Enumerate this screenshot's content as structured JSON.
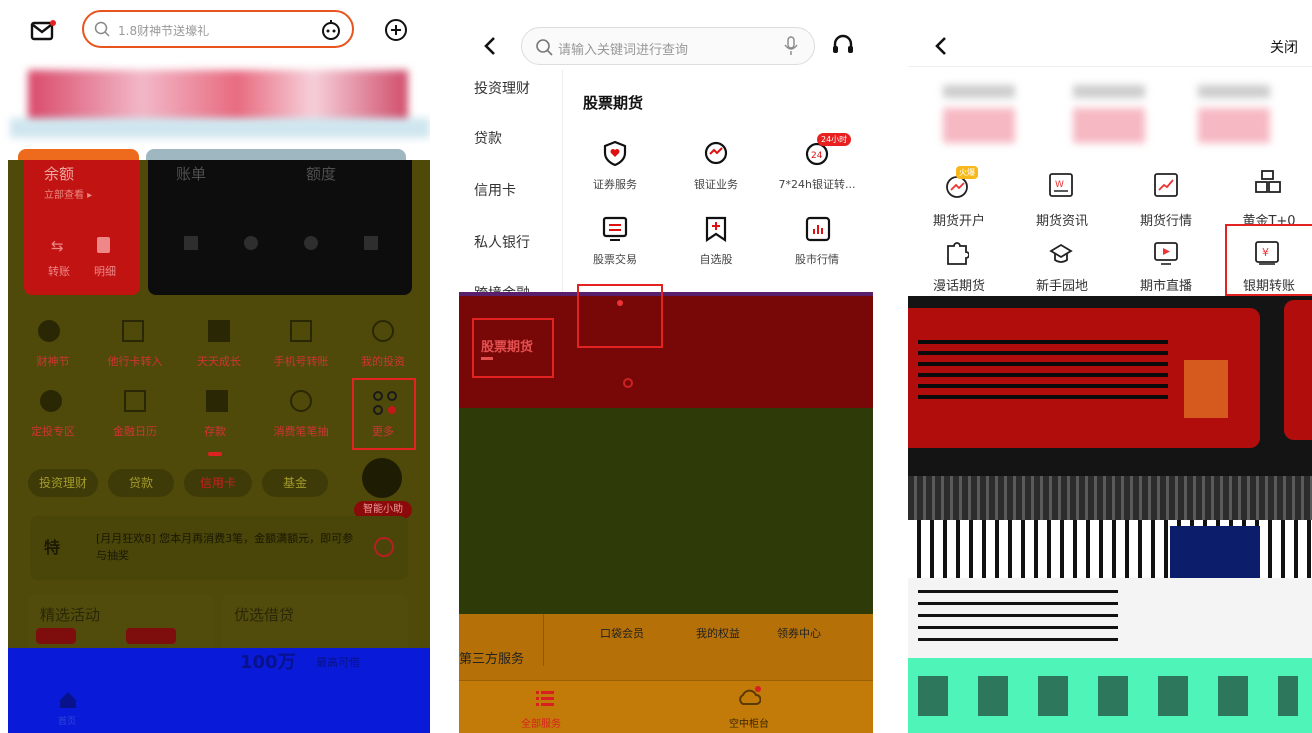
{
  "panel1": {
    "search_placeholder": "1.8财神节送壕礼",
    "tabs": [
      "余额",
      "账单",
      "额度"
    ],
    "balance_link": "立部查看 ▸",
    "quick_actions": [
      "转账",
      "明细"
    ],
    "grid_row1": [
      "财神节",
      "他行卡转入",
      "天天成长",
      "手机号转账",
      "我的投资"
    ],
    "grid_row2": [
      "定投专区",
      "金融日历",
      "存款",
      "消费笔笔抽",
      "更多"
    ],
    "categories": [
      "投资理财",
      "贷款",
      "信用卡",
      "基金"
    ],
    "notice": "[月月狂欢8] 您本月再消费3笔，金额满额元，即可参与抽奖",
    "section_left": "精选活动",
    "section_right": "优选借贷",
    "loan_amount": "100万",
    "loan_caption": "最高可借",
    "assistant_badge": "智能小助",
    "bottom_nav": "首页"
  },
  "panel2": {
    "search_placeholder": "请输入关键词进行查询",
    "left_nav": [
      "投资理财",
      "贷款",
      "信用卡",
      "私人银行",
      "跨境金融"
    ],
    "section_title": "股票期货",
    "services": [
      {
        "label": "证券服务",
        "icon": "shield-heart-icon"
      },
      {
        "label": "银证业务",
        "icon": "exchange-icon"
      },
      {
        "label": "7*24h银证转...",
        "icon": "clock-24-icon"
      },
      {
        "label": "股票交易",
        "icon": "terminal-icon"
      },
      {
        "label": "自选股",
        "icon": "bookmark-plus-icon"
      },
      {
        "label": "股市行情",
        "icon": "bar-chart-icon"
      }
    ],
    "badge_24": "24小时",
    "selected_nav": "股票期货",
    "bottom_services": [
      "口袋会员",
      "我的权益",
      "领券中心"
    ],
    "third_party": "第三方服务",
    "tab_all": "全部服务",
    "tab_air": "空中柜台"
  },
  "panel3": {
    "close_label": "关闭",
    "row1": [
      {
        "label": "期货开户",
        "icon": "account-open-icon"
      },
      {
        "label": "期货资讯",
        "icon": "news-icon"
      },
      {
        "label": "期货行情",
        "icon": "trend-chart-icon"
      },
      {
        "label": "黄金T+0",
        "icon": "gold-bars-icon"
      }
    ],
    "row2": [
      {
        "label": "漫话期货",
        "icon": "puzzle-icon"
      },
      {
        "label": "新手园地",
        "icon": "graduation-icon"
      },
      {
        "label": "期市直播",
        "icon": "live-play-icon"
      },
      {
        "label": "银期转账",
        "icon": "yen-transfer-icon"
      }
    ],
    "hot_badge": "火爆"
  }
}
